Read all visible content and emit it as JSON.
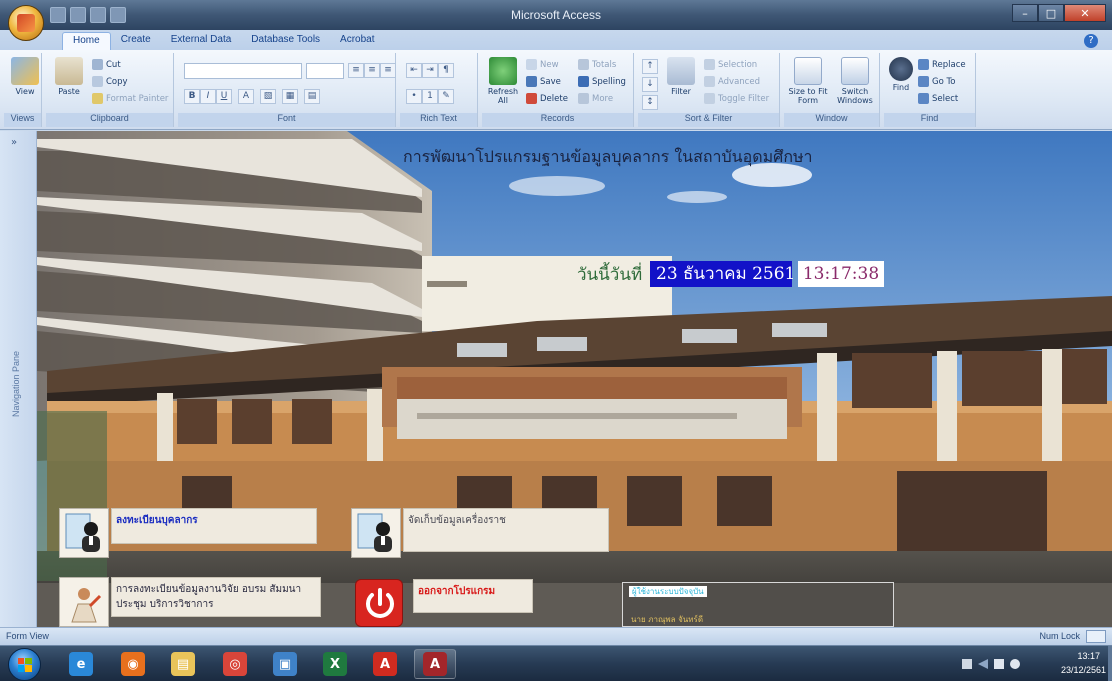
{
  "window": {
    "title": "Microsoft Access",
    "min_glyph": "–",
    "max_glyph": "□",
    "close_glyph": "✕"
  },
  "ribbon": {
    "tabs": [
      "Home",
      "Create",
      "External Data",
      "Database Tools",
      "Acrobat"
    ],
    "active_tab": "Home",
    "groups": {
      "views": {
        "label": "Views",
        "view_btn": "View"
      },
      "clipboard": {
        "label": "Clipboard",
        "paste": "Paste",
        "cut": "Cut",
        "copy": "Copy",
        "format_painter": "Format Painter"
      },
      "font": {
        "label": "Font",
        "bold": "B",
        "italic": "I",
        "underline": "U",
        "font_color": "A"
      },
      "rich_text": {
        "label": "Rich Text"
      },
      "records": {
        "label": "Records",
        "refresh": "Refresh All",
        "new": "New",
        "save": "Save",
        "delete": "Delete",
        "totals": "Totals",
        "spelling": "Spelling",
        "more": "More"
      },
      "sort_filter": {
        "label": "Sort & Filter",
        "filter": "Filter",
        "selection": "Selection",
        "advanced": "Advanced",
        "toggle_filter": "Toggle Filter"
      },
      "window": {
        "label": "Window",
        "fit_form": "Size to Fit Form",
        "switch_windows": "Switch Windows"
      },
      "find": {
        "label": "Find",
        "find": "Find",
        "replace": "Replace",
        "goto": "Go To",
        "select": "Select"
      }
    }
  },
  "navigation_pane": {
    "title": "Navigation Pane",
    "chevron": "»"
  },
  "form": {
    "title": "การพัฒนาโปรแกรมฐานข้อมูลบุคลากร ในสถาบันอุดมศึกษา",
    "today_label": "วันนี้วันที่",
    "date_value": "23 ธันวาคม 2561",
    "time_value": "13:17:38",
    "tiles": {
      "register": "ลงทะเบียนบุคลากร",
      "equipment": "จัดเก็บข้อมูลเครื่องราช",
      "research": "การลงทะเบียนข้อมูลงานวิจัย อบรม สัมมนา ประชุม บริการวิชาการ",
      "exit": "ออกจากโปรแกรม"
    },
    "info_panel": {
      "header": "ผู้ใช้งานระบบปัจจุบัน",
      "user": "นาย ภาณุพล  จันทร์ดี"
    }
  },
  "statusbar": {
    "left": "Form View",
    "right": "Num Lock"
  },
  "taskbar": {
    "apps": [
      {
        "name": "internet-explorer",
        "glyph": "e",
        "color": "#2a88d8",
        "running": false
      },
      {
        "name": "firefox",
        "glyph": "◉",
        "color": "#e8701d",
        "running": false
      },
      {
        "name": "file-explorer",
        "glyph": "▤",
        "color": "#e9c45a",
        "running": false
      },
      {
        "name": "chrome",
        "glyph": "◎",
        "color": "#d9453a",
        "running": false
      },
      {
        "name": "remote-app",
        "glyph": "▣",
        "color": "#3f82c8",
        "running": false
      },
      {
        "name": "excel",
        "glyph": "X",
        "color": "#1f7a3f",
        "running": false
      },
      {
        "name": "acrobat",
        "glyph": "A",
        "color": "#d02b20",
        "running": false
      },
      {
        "name": "access",
        "glyph": "A",
        "color": "#a3262a",
        "running": true
      }
    ],
    "clock_time": "13:17",
    "clock_date": "23/12/2561"
  },
  "colors": {
    "date_bg": "#1212c8",
    "exit_red": "#d81818",
    "register_blue": "#1a2cc0"
  }
}
